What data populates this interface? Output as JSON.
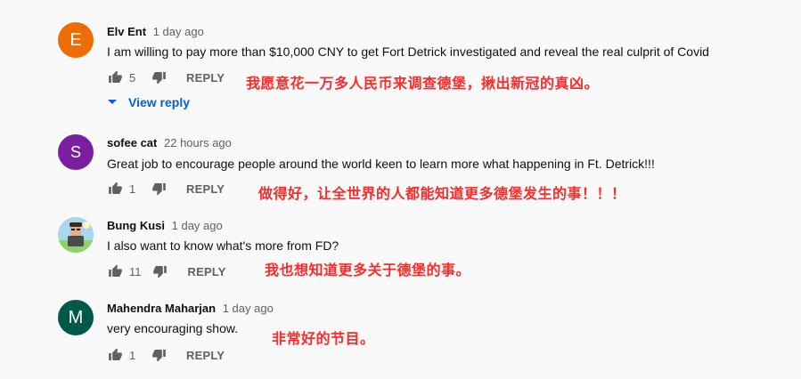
{
  "comments": [
    {
      "avatar_letter": "E",
      "avatar_color": "#ef6c00",
      "author": "Elv Ent",
      "time": "1 day ago",
      "text": "I am willing to pay more than $10,000 CNY to get Fort Detrick investigated and reveal the real culprit of Covid",
      "likes": "5",
      "reply_label": "REPLY",
      "annotation": "我愿意花一万多人民币来调查德堡，揪出新冠的真凶。"
    },
    {
      "avatar_letter": "S",
      "avatar_color": "#7b1fa2",
      "author": "sofee cat",
      "time": "22 hours ago",
      "text": "Great job to encourage people around the world keen to learn more  what happening in Ft. Detrick!!!",
      "likes": "1",
      "reply_label": "REPLY",
      "annotation": "做得好，让全世界的人都能知道更多德堡发生的事！！！"
    },
    {
      "avatar_letter": "",
      "avatar_color": "#a9d6f0",
      "author": "Bung Kusi",
      "time": "1 day ago",
      "text": "I also want to know what's more from FD?",
      "likes": "11",
      "reply_label": "REPLY",
      "annotation": "我也想知道更多关于德堡的事。"
    },
    {
      "avatar_letter": "M",
      "avatar_color": "#00584a",
      "author": "Mahendra Maharjan",
      "time": "1 day ago",
      "text": "very encouraging show.",
      "likes": "1",
      "reply_label": "REPLY",
      "annotation": "非常好的节目。"
    }
  ],
  "view_replies_label": "View reply",
  "icons": {
    "like": "thumb-up-icon",
    "dislike": "thumb-down-icon",
    "expand": "chevron-down-icon"
  },
  "colors": {
    "background": "#f9f9f9",
    "annotation": "#ff2a2a",
    "link": "#065fd4",
    "secondary_text": "#606060"
  }
}
